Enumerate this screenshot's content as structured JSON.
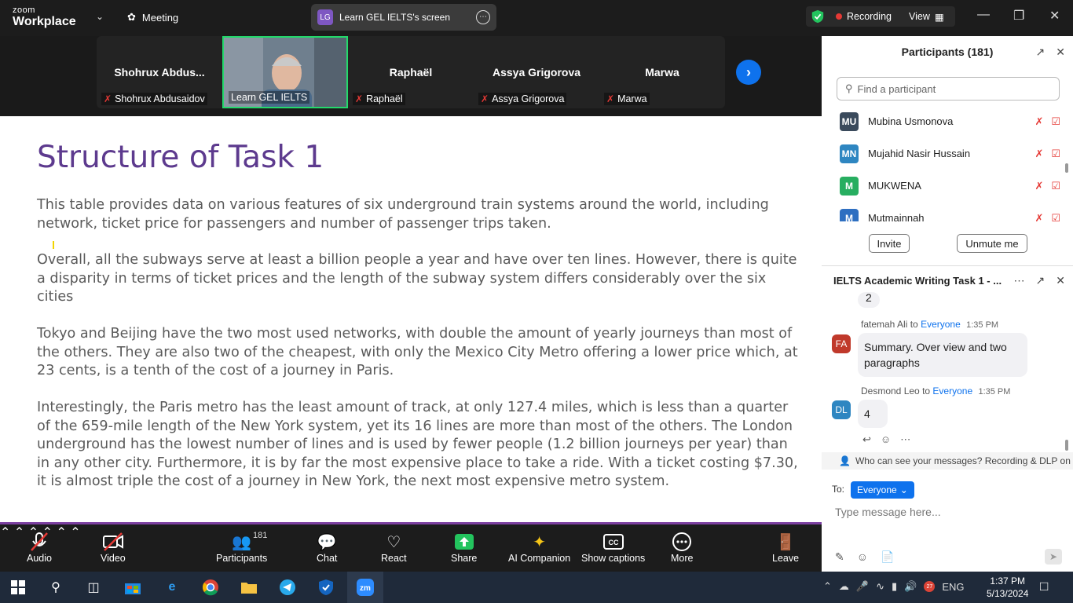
{
  "topbar": {
    "brand_line1": "zoom",
    "brand_line2": "Workplace",
    "meeting_label": "Meeting",
    "share_initials": "LG",
    "share_label": "Learn GEL IELTS's screen",
    "recording_label": "Recording",
    "view_label": "View"
  },
  "gallery": {
    "tiles": [
      {
        "big": "Shohrux  Abdus...",
        "name": "Shohrux Abdusaidov"
      },
      {
        "big": "",
        "name": "Learn GEL IELTS"
      },
      {
        "big": "Raphaël",
        "name": "Raphaël"
      },
      {
        "big": "Assya Grigorova",
        "name": "Assya Grigorova"
      },
      {
        "big": "Marwa",
        "name": "Marwa"
      }
    ]
  },
  "slide": {
    "title": "Structure of Task 1",
    "p1": "This table provides data on various features of six underground train systems around the world, including network, ticket price for passengers and number of passenger trips taken.",
    "p2": "Overall, all the subways serve at least a billion people a year and have over ten lines. However, there is quite a disparity in terms of ticket prices and the length of the subway system differs considerably over the six cities",
    "p3": "Tokyo and Beijing have the two most used networks, with double the amount of yearly journeys than most of the others. They are also two of the cheapest, with only the Mexico City Metro offering a lower price which, at 23 cents, is a tenth of the cost of a journey in Paris.",
    "p4": "Interestingly, the Paris metro has the least amount of track, at only 127.4 miles, which is less than a quarter of the 659-mile length of the New York system, yet its 16 lines are more than most of the others. The London underground has the lowest number of lines and is used by fewer people (1.2 billion journeys per year) than in any other city. Furthermore, it is by far the most expensive place to take a ride. With a ticket costing $7.30, it is almost triple the cost of a journey in New York, the next most expensive metro system."
  },
  "toolbar": {
    "audio": "Audio",
    "video": "Video",
    "participants": "Participants",
    "participants_count": "181",
    "chat": "Chat",
    "react": "React",
    "share": "Share",
    "ai": "AI Companion",
    "captions": "Show captions",
    "more": "More",
    "leave": "Leave"
  },
  "participants_panel": {
    "title": "Participants (181)",
    "search_placeholder": "Find a participant",
    "list": [
      {
        "initials": "MU",
        "name": "Mubina Usmonova",
        "color": "#3a4a5c"
      },
      {
        "initials": "MN",
        "name": "Mujahid Nasir Hussain",
        "color": "#2e86c1"
      },
      {
        "initials": "M",
        "name": "MUKWENA",
        "color": "#27ae60"
      },
      {
        "initials": "M",
        "name": "Mutmainnah",
        "color": "#2e6fc1"
      }
    ],
    "invite": "Invite",
    "unmute": "Unmute me"
  },
  "chat_panel": {
    "title": "IELTS Academic Writing Task 1 - ...",
    "prev_bubble": "2",
    "messages": [
      {
        "initials": "FA",
        "color": "#c0392b",
        "sender": "fatemah Ali",
        "to": "to",
        "target": "Everyone",
        "time": "1:35 PM",
        "text": "Summary.  Over view and two paragraphs"
      },
      {
        "initials": "DL",
        "color": "#2e86c1",
        "sender": "Desmond Leo",
        "to": "to",
        "target": "Everyone",
        "time": "1:35 PM",
        "text": "4"
      }
    ],
    "dlp_notice": "Who can see your messages? Recording & DLP on",
    "to_label": "To:",
    "to_target": "Everyone",
    "placeholder": "Type message here..."
  },
  "taskbar": {
    "lang": "ENG",
    "time": "1:37 PM",
    "date": "5/13/2024",
    "chrome_badge": "27"
  }
}
